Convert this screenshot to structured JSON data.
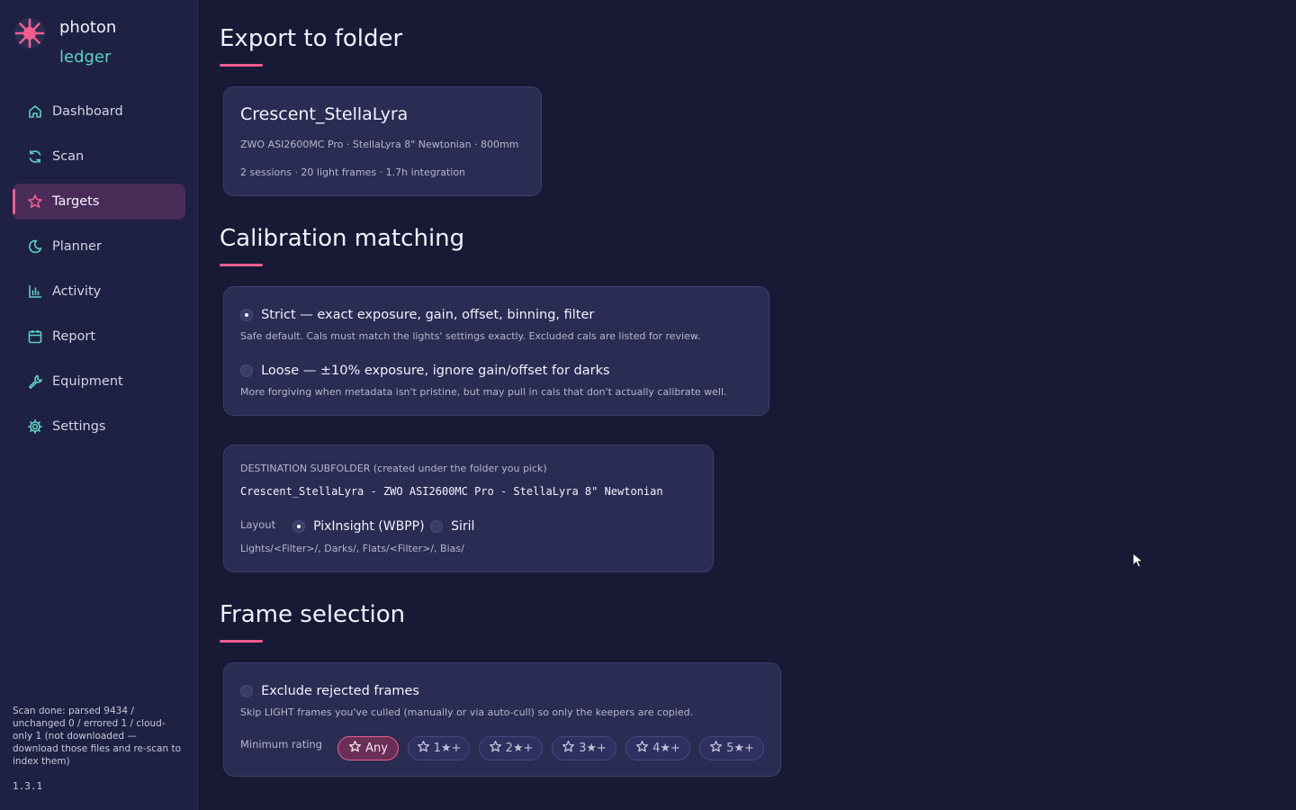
{
  "brand": {
    "line1": "photon",
    "line2": "ledger"
  },
  "nav": [
    {
      "label": "Dashboard",
      "icon": "home-icon",
      "active": false
    },
    {
      "label": "Scan",
      "icon": "refresh-icon",
      "active": false
    },
    {
      "label": "Targets",
      "icon": "star-icon",
      "active": true
    },
    {
      "label": "Planner",
      "icon": "moon-icon",
      "active": false
    },
    {
      "label": "Activity",
      "icon": "bar-chart-icon",
      "active": false
    },
    {
      "label": "Report",
      "icon": "calendar-icon",
      "active": false
    },
    {
      "label": "Equipment",
      "icon": "wrench-icon",
      "active": false
    },
    {
      "label": "Settings",
      "icon": "gear-icon",
      "active": false
    }
  ],
  "scan_status": "Scan done: parsed 9434 / unchanged 0 / errored 1 / cloud-only 1 (not downloaded — download those files and re-scan to index them)",
  "version": "1.3.1",
  "export": {
    "title": "Export to folder",
    "target_name": "Crescent_StellaLyra",
    "equipment": "ZWO ASI2600MC Pro · StellaLyra 8\" Newtonian · 800mm",
    "summary": "2 sessions · 20 light frames · 1.7h integration"
  },
  "calibration": {
    "title": "Calibration matching",
    "strict_label": "Strict — exact exposure, gain, offset, binning, filter",
    "strict_desc": "Safe default. Cals must match the lights' settings exactly. Excluded cals are listed for review.",
    "loose_label": "Loose — ±10% exposure, ignore gain/offset for darks",
    "loose_desc": "More forgiving when metadata isn't pristine, but may pull in cals that don't actually calibrate well.",
    "selected": "strict"
  },
  "destination": {
    "label": "DESTINATION SUBFOLDER (created under the folder you pick)",
    "path": "Crescent_StellaLyra - ZWO ASI2600MC Pro - StellaLyra 8\" Newtonian",
    "layout_label": "Layout",
    "layout_options": [
      "PixInsight (WBPP)",
      "Siril"
    ],
    "layout_selected": "PixInsight (WBPP)",
    "layout_desc": "Lights/<Filter>/, Darks/, Flats/<Filter>/, Bias/"
  },
  "frames": {
    "title": "Frame selection",
    "exclude_label": "Exclude rejected frames",
    "exclude_checked": false,
    "exclude_desc": "Skip LIGHT frames you've culled (manually or via auto-cull) so only the keepers are copied.",
    "min_rating_label": "Minimum rating",
    "ratings": [
      "Any",
      "1★+",
      "2★+",
      "3★+",
      "4★+",
      "5★+"
    ],
    "rating_selected": "Any"
  },
  "colors": {
    "accent": "#ef5d8f",
    "teal": "#5fd0c4",
    "bg": "#181a35",
    "card": "#2a2c54"
  }
}
